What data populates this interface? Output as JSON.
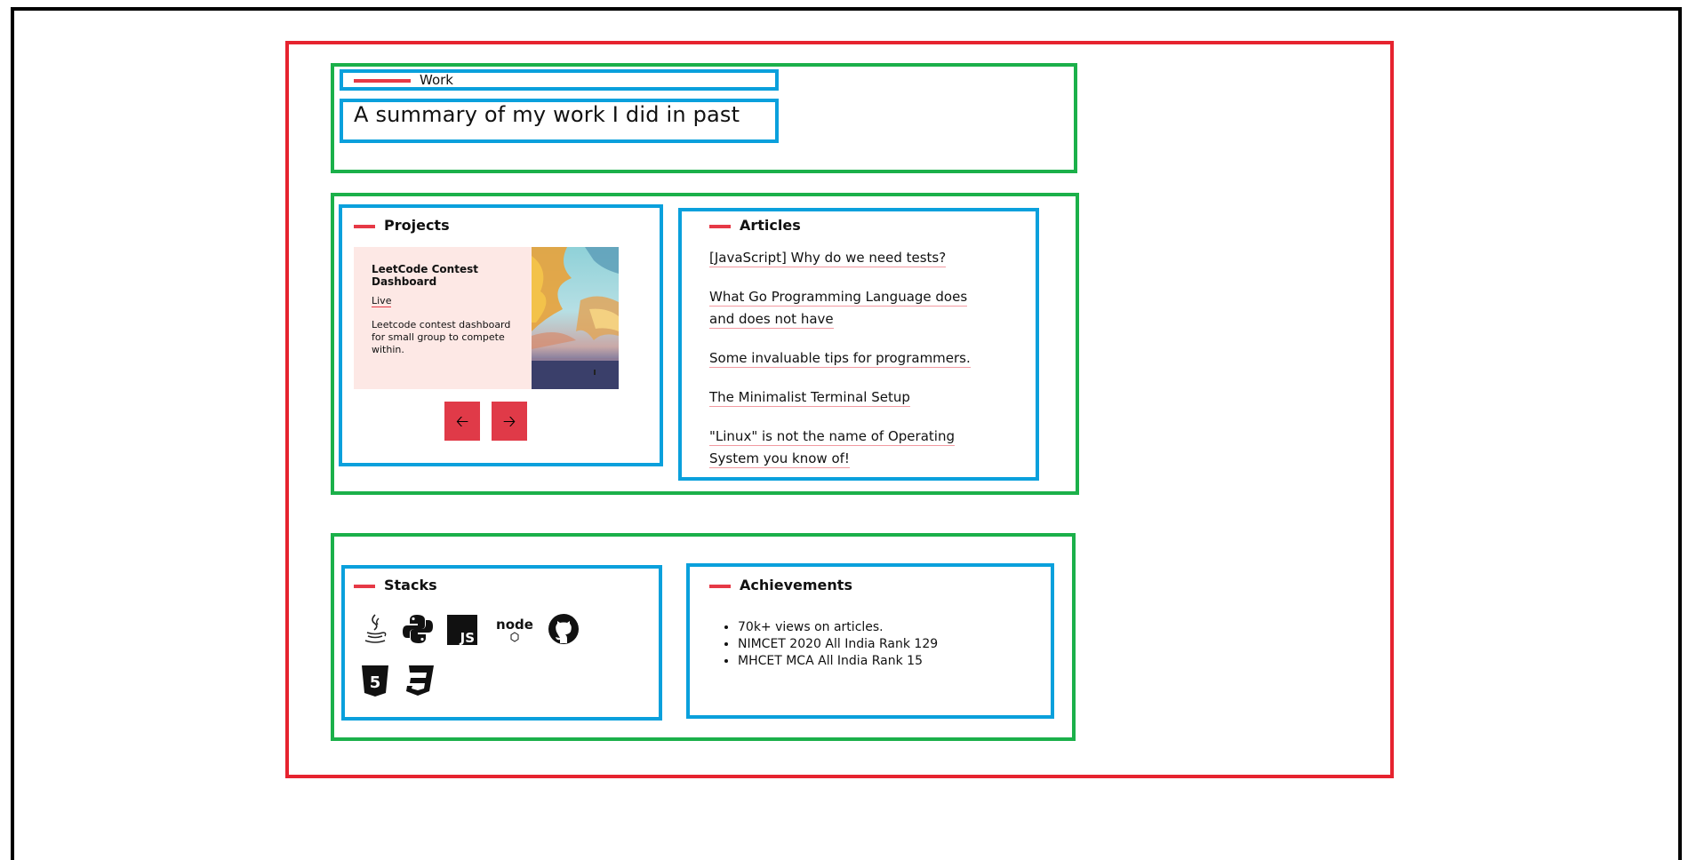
{
  "header": {
    "eyebrow": "Work",
    "title": "A summary of my work I did in past"
  },
  "projects": {
    "heading": "Projects",
    "card": {
      "title": "LeetCode Contest Dashboard",
      "live_label": "Live",
      "description": "Leetcode contest dashboard for small group to compete within."
    },
    "prev_icon": "arrow-left-icon",
    "next_icon": "arrow-right-icon"
  },
  "articles": {
    "heading": "Articles",
    "items": [
      "[JavaScript] Why do we need tests?",
      "What Go Programming Language does and does not have",
      "Some invaluable tips for programmers.",
      "The Minimalist Terminal Setup",
      "\"Linux\" is not the name of Operating System you know of!"
    ]
  },
  "stacks": {
    "heading": "Stacks",
    "icons": [
      "java-icon",
      "python-icon",
      "javascript-icon",
      "nodejs-icon",
      "github-icon",
      "html5-icon",
      "css3-icon"
    ],
    "js_text": "JS",
    "node_text": "node",
    "html_text": "5",
    "css_text": "3"
  },
  "achievements": {
    "heading": "Achievements",
    "items": [
      "70k+ views on articles.",
      "NIMCET 2020 All India Rank 129",
      "MHCET MCA All India Rank 15"
    ]
  },
  "colors": {
    "accent": "#e63946",
    "green_outline": "#1bb04a",
    "blue_outline": "#0aa0dc",
    "red_outline": "#e6232f",
    "card_bg": "#fde8e5"
  }
}
